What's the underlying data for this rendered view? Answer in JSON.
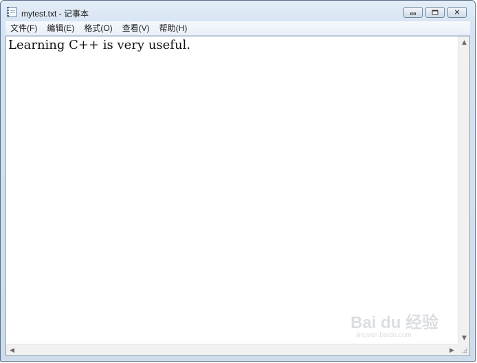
{
  "window": {
    "title": "mytest.txt - 记事本",
    "icon": "notepad-icon",
    "controls": {
      "minimize": "minimize-icon",
      "maximize": "restore-icon",
      "close": "✕"
    }
  },
  "menu": {
    "items": [
      {
        "label": "文件(F)"
      },
      {
        "label": "编辑(E)"
      },
      {
        "label": "格式(O)"
      },
      {
        "label": "查看(V)"
      },
      {
        "label": "帮助(H)"
      }
    ]
  },
  "editor": {
    "content": "Learning C++ is very useful."
  },
  "scrollbars": {
    "up": "▲",
    "down": "▼",
    "left": "◀",
    "right": "▶"
  },
  "watermark": {
    "brand": "Bai du 经验",
    "url": "jingyan.baidu.com"
  }
}
